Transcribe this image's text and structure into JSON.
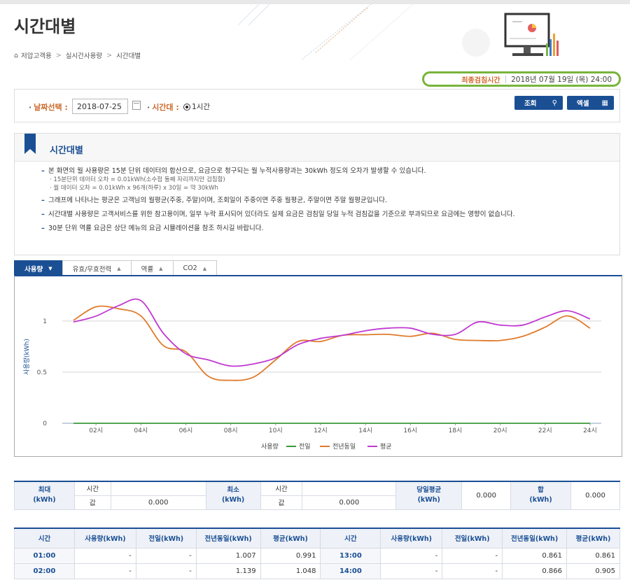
{
  "header": {
    "title": "시간대별",
    "breadcrumb": [
      "저압고객용",
      "실시간사용량",
      "시간대별"
    ],
    "inspection_label": "최종검침시간",
    "inspection_value": "2018년 07월 19일 (목) 24:00"
  },
  "search": {
    "date_label": "날짜선택 :",
    "date_value": "2018-07-25",
    "time_label": "시간대 :",
    "time_option": "1시간",
    "query_button": "조회",
    "excel_button": "엑셀"
  },
  "notice": {
    "title": "시간대별",
    "item1": "본 화면의 월 사용량은 15분 단위 데이터의 합산으로, 요금으로 청구되는 월 누적사용량과는 30kWh 정도의 오차가 발생할 수 있습니다.",
    "item1_sub1": "15분단위 데이터 오차 = 0.01kWh(소수점 둘째 자리까지만 검침함)",
    "item1_sub2": "월 데이터 오차 = 0.01kWh x 96개(하루) x 30일 = 약 30kWh",
    "item2": "그래프에 나타나는 평균은 고객님의 월평균(주중, 주말)이며, 조회일이 주중이면 주중 월평균, 주말이면 주말 월평균입니다.",
    "item3": "시간대별 사용량은 고객서비스를 위한 참고용이며, 일부 누락 표시되어 있더라도 실제 요금은 검침일 당일 누적 검침값을 기준으로 부과되므로 요금에는 영향이 없습니다.",
    "item4": "30분 단위 역률 요금은 상단 메뉴의 요금 시뮬레이션을 참조 하시길 바랍니다."
  },
  "tabs": [
    "사용량",
    "유효/무효전력",
    "역률",
    "CO2"
  ],
  "chart_data": {
    "type": "line",
    "x": [
      "01시",
      "02시",
      "03시",
      "04시",
      "05시",
      "06시",
      "07시",
      "08시",
      "09시",
      "10시",
      "11시",
      "12시",
      "13시",
      "14시",
      "15시",
      "16시",
      "17시",
      "18시",
      "19시",
      "20시",
      "21시",
      "22시",
      "23시",
      "24시"
    ],
    "xticks": [
      "02시",
      "04시",
      "06시",
      "08시",
      "10시",
      "12시",
      "14시",
      "16시",
      "18시",
      "20시",
      "22시",
      "24시"
    ],
    "ylabel": "사용량(kWh)",
    "yticks": [
      0,
      0.5,
      1
    ],
    "ylim": [
      0,
      1.3
    ],
    "series": [
      {
        "name": "전일",
        "color": "#3a9a3a",
        "values": [
          0,
          0,
          0,
          0,
          0,
          0,
          0,
          0,
          0,
          0,
          0,
          0,
          0,
          0,
          0,
          0,
          0,
          0,
          0,
          0,
          0,
          0,
          0,
          0
        ]
      },
      {
        "name": "전년동일",
        "color": "#e07b2c",
        "values": [
          1.007,
          1.139,
          1.12,
          1.05,
          0.76,
          0.7,
          0.46,
          0.42,
          0.45,
          0.62,
          0.8,
          0.8,
          0.861,
          0.866,
          0.87,
          0.85,
          0.88,
          0.82,
          0.81,
          0.81,
          0.85,
          0.94,
          1.05,
          0.93
        ]
      },
      {
        "name": "평균",
        "color": "#c03ad0",
        "values": [
          0.991,
          1.048,
          1.15,
          1.2,
          0.88,
          0.68,
          0.62,
          0.56,
          0.58,
          0.64,
          0.77,
          0.83,
          0.861,
          0.905,
          0.93,
          0.93,
          0.87,
          0.87,
          0.99,
          0.96,
          0.96,
          1.04,
          1.1,
          1.02
        ]
      }
    ]
  },
  "summary": {
    "max_label": "최대\n(kWh)",
    "min_label": "최소\n(kWh)",
    "time_label": "시간",
    "value_label": "값",
    "max_value": "0.000",
    "min_value": "0.000",
    "day_avg_label": "당일평균\n(kWh)",
    "day_avg_value": "0.000",
    "sum_label": "합\n(kWh)",
    "sum_value": "0.000"
  },
  "table": {
    "headers": [
      "시간",
      "사용량(kWh)",
      "전일(kWh)",
      "전년동일(kWh)",
      "평균(kWh)",
      "시간",
      "사용량(kWh)",
      "전일(kWh)",
      "전년동일(kWh)",
      "평균(kWh)"
    ],
    "rows": [
      [
        "01:00",
        "-",
        "-",
        "1.007",
        "0.991",
        "13:00",
        "-",
        "-",
        "0.861",
        "0.861"
      ],
      [
        "02:00",
        "-",
        "-",
        "1.139",
        "1.048",
        "14:00",
        "-",
        "-",
        "0.866",
        "0.905"
      ]
    ]
  }
}
